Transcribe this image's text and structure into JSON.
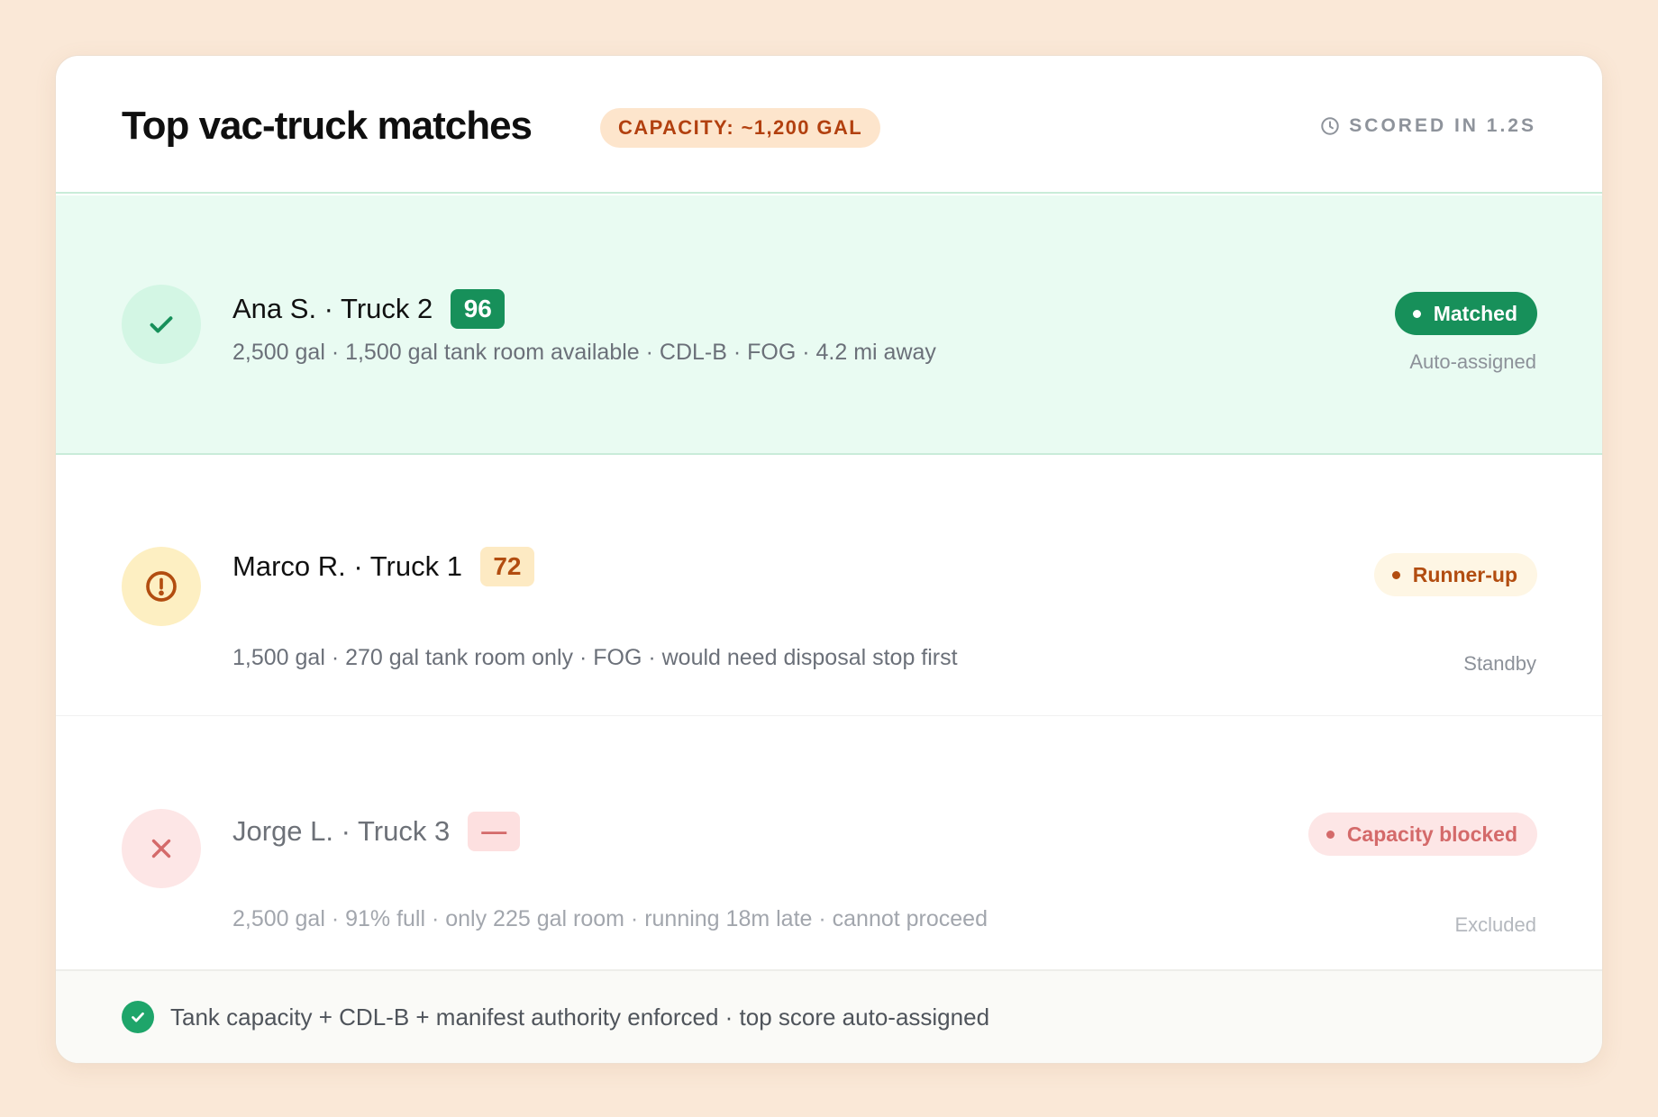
{
  "header": {
    "title": "Top vac-truck matches",
    "capacity_badge": "CAPACITY: ~1,200 GAL",
    "scored_label": "SCORED IN 1.2S",
    "scored_icon": "clock-icon"
  },
  "matches": [
    {
      "name": "Ana S. · Truck 2",
      "score": "96",
      "details": "2,500 gal · 1,500 gal tank room available · CDL-B · FOG · 4.2 mi away",
      "status": "Matched",
      "sub_status": "Auto-assigned",
      "icon": "check-icon",
      "accent": "#17905a"
    },
    {
      "name": "Marco R. · Truck 1",
      "score": "72",
      "details": "1,500 gal · 270 gal tank room only · FOG · would need disposal stop first",
      "status": "Runner-up",
      "sub_status": "Standby",
      "icon": "warning-icon",
      "accent": "#b24d10"
    },
    {
      "name": "Jorge L. · Truck 3",
      "score": "—",
      "details": "2,500 gal · 91% full · only 225 gal room · running 18m late · cannot proceed",
      "status": "Capacity blocked",
      "sub_status": "Excluded",
      "icon": "x-icon",
      "accent": "#d46a6a"
    }
  ],
  "footer": {
    "icon": "check-circle-icon",
    "text": "Tank capacity + CDL-B + manifest authority enforced · top score auto-assigned"
  }
}
